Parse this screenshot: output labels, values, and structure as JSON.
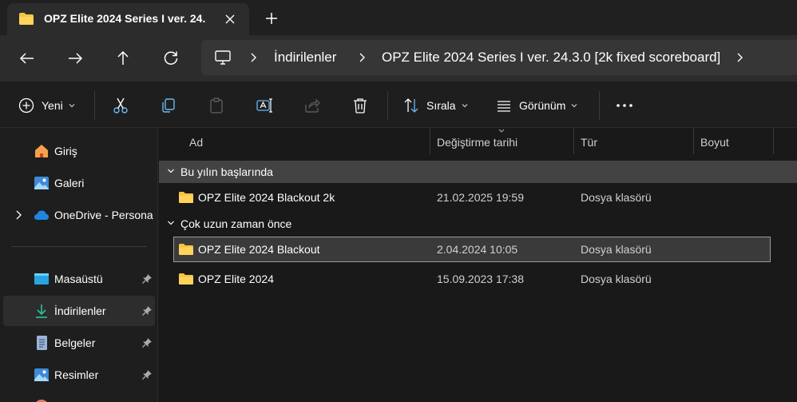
{
  "tab": {
    "title": "OPZ Elite 2024 Series I ver. 24."
  },
  "breadcrumb": {
    "items": [
      "İndirilenler",
      "OPZ Elite 2024 Series I ver. 24.3.0 [2k fixed scoreboard]"
    ]
  },
  "toolbar": {
    "new_label": "Yeni",
    "sort_label": "Sırala",
    "view_label": "Görünüm"
  },
  "sidebar": {
    "items": [
      {
        "label": "Giriş",
        "icon": "home-icon"
      },
      {
        "label": "Galeri",
        "icon": "gallery-icon"
      },
      {
        "label": "OneDrive - Persona",
        "icon": "cloud-icon"
      },
      {
        "label": "Masaüstü",
        "icon": "desktop-icon"
      },
      {
        "label": "İndirilenler",
        "icon": "download-icon"
      },
      {
        "label": "Belgeler",
        "icon": "document-icon"
      },
      {
        "label": "Resimler",
        "icon": "pictures-icon"
      }
    ]
  },
  "columns": [
    "Ad",
    "Değiştirme tarihi",
    "Tür",
    "Boyut"
  ],
  "groups": [
    {
      "label": "Bu yılın başlarında",
      "rows": [
        {
          "name": "OPZ Elite 2024 Blackout 2k",
          "date": "21.02.2025 19:59",
          "type": "Dosya klasörü"
        }
      ]
    },
    {
      "label": "Çok uzun zaman önce",
      "rows": [
        {
          "name": "OPZ Elite 2024 Blackout",
          "date": "2.04.2024 10:05",
          "type": "Dosya klasörü"
        },
        {
          "name": "OPZ Elite 2024",
          "date": "15.09.2023 17:38",
          "type": "Dosya klasörü"
        }
      ]
    }
  ],
  "colors": {
    "folder": "#f6c540",
    "background": "#191919",
    "selection": "#3a3a3a",
    "accent": "#4cc2ff"
  }
}
